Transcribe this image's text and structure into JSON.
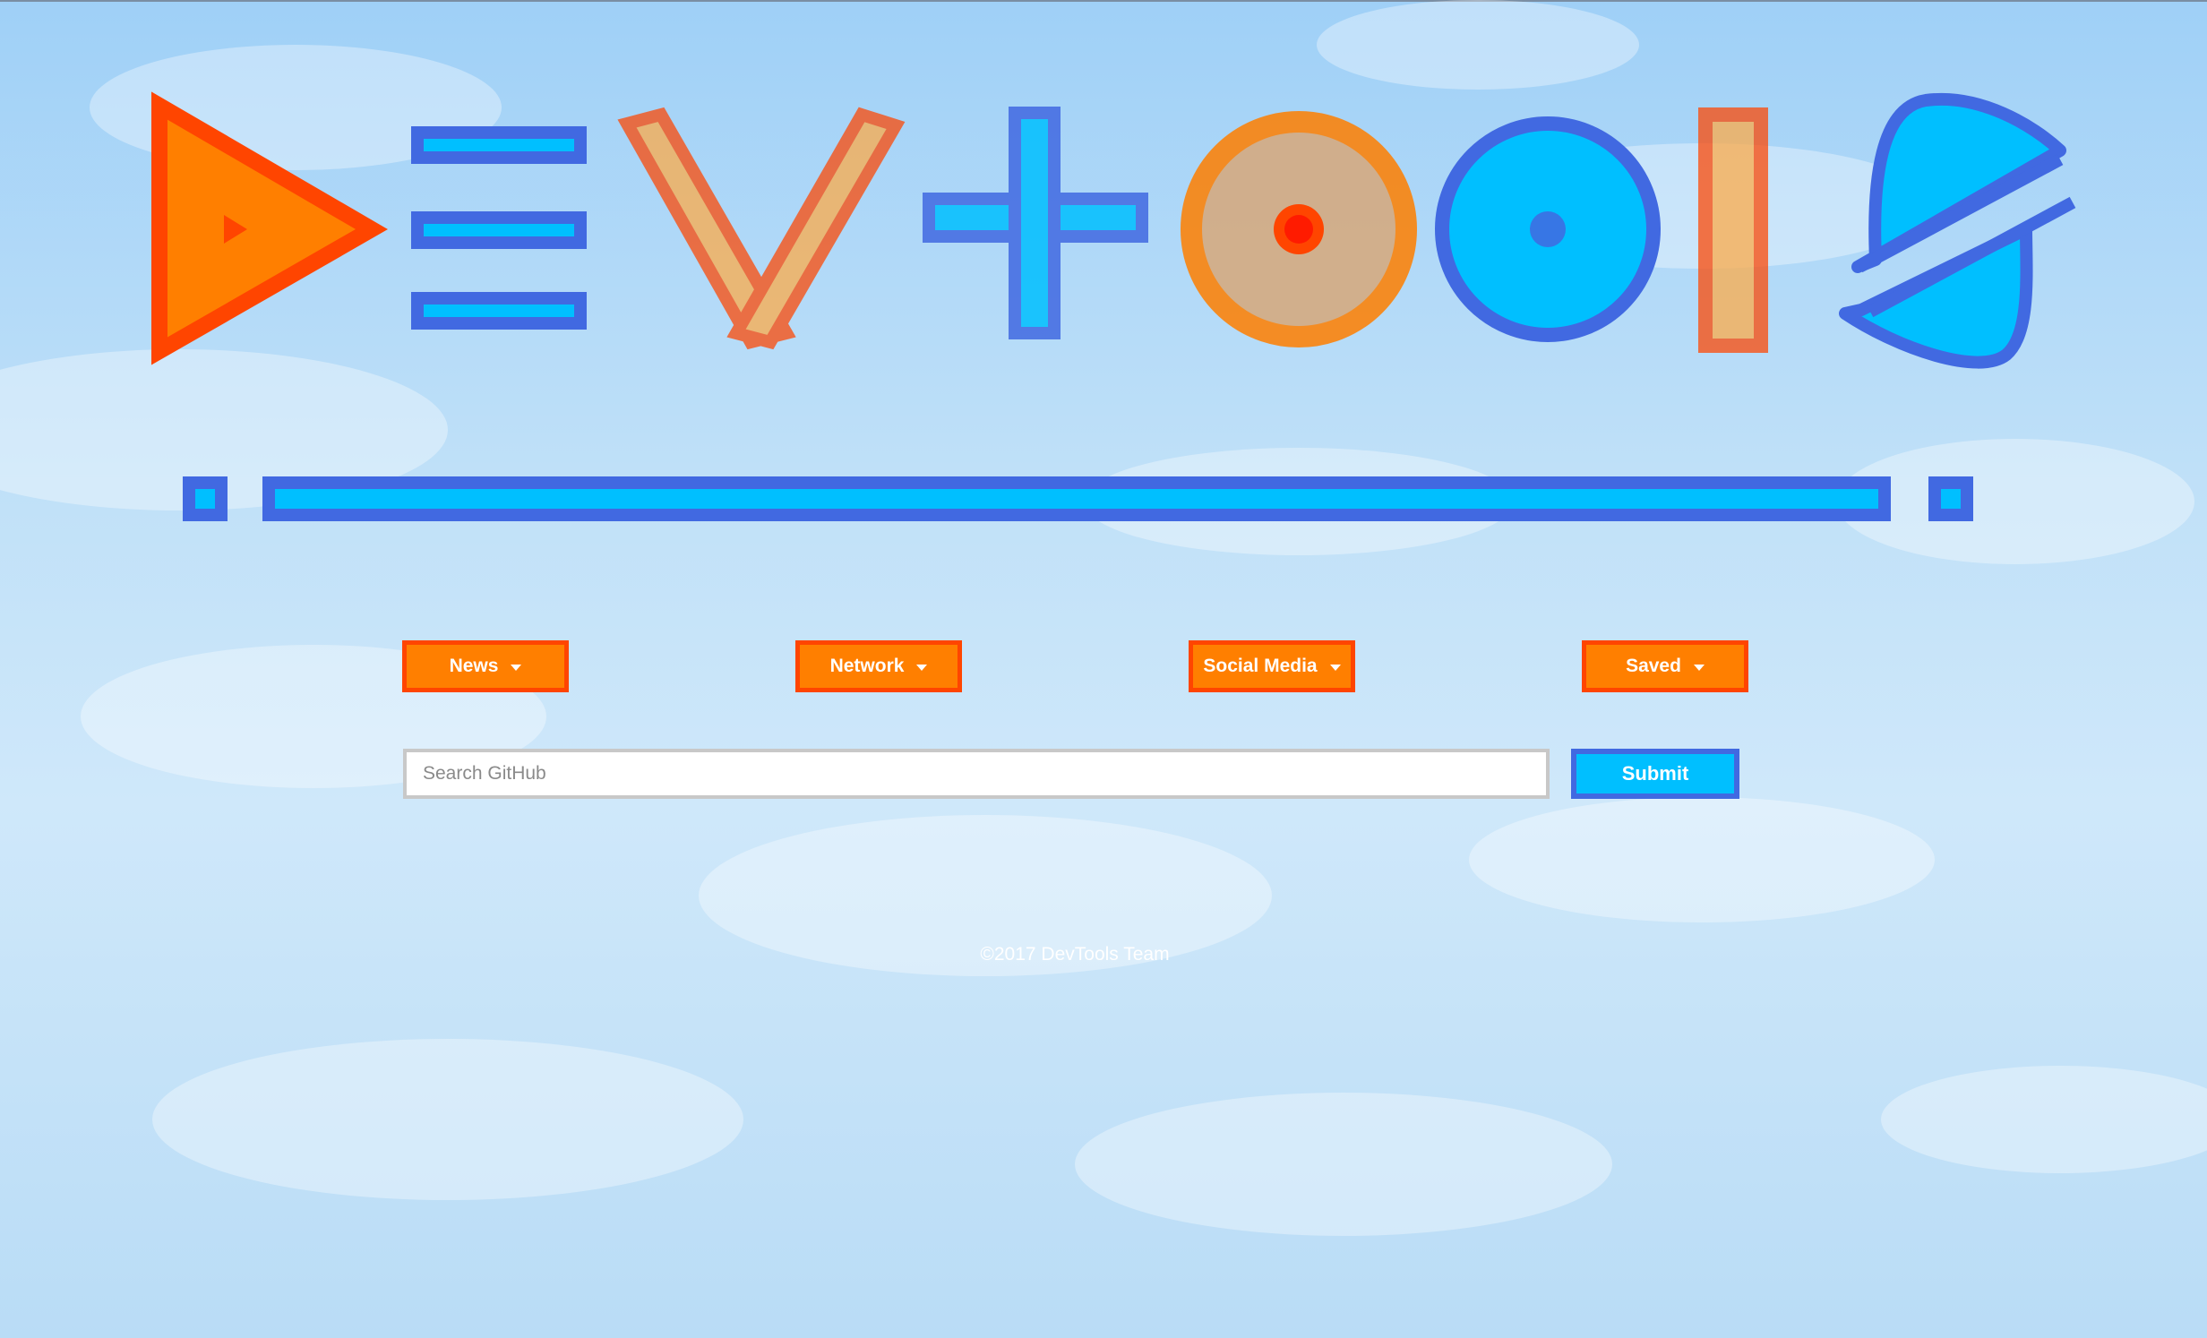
{
  "logo": {
    "text": "DevTools"
  },
  "nav": {
    "items": [
      {
        "label": "News"
      },
      {
        "label": "Network"
      },
      {
        "label": "Social Media"
      },
      {
        "label": "Saved"
      }
    ]
  },
  "search": {
    "placeholder": "Search GitHub",
    "value": "",
    "submit_label": "Submit"
  },
  "footer": {
    "text": "©2017 DevTools Team"
  },
  "colors": {
    "orange": "#ff7f00",
    "orange_red": "#ff4500",
    "royal_blue": "#4169e1",
    "deep_sky_blue": "#00bfff"
  }
}
